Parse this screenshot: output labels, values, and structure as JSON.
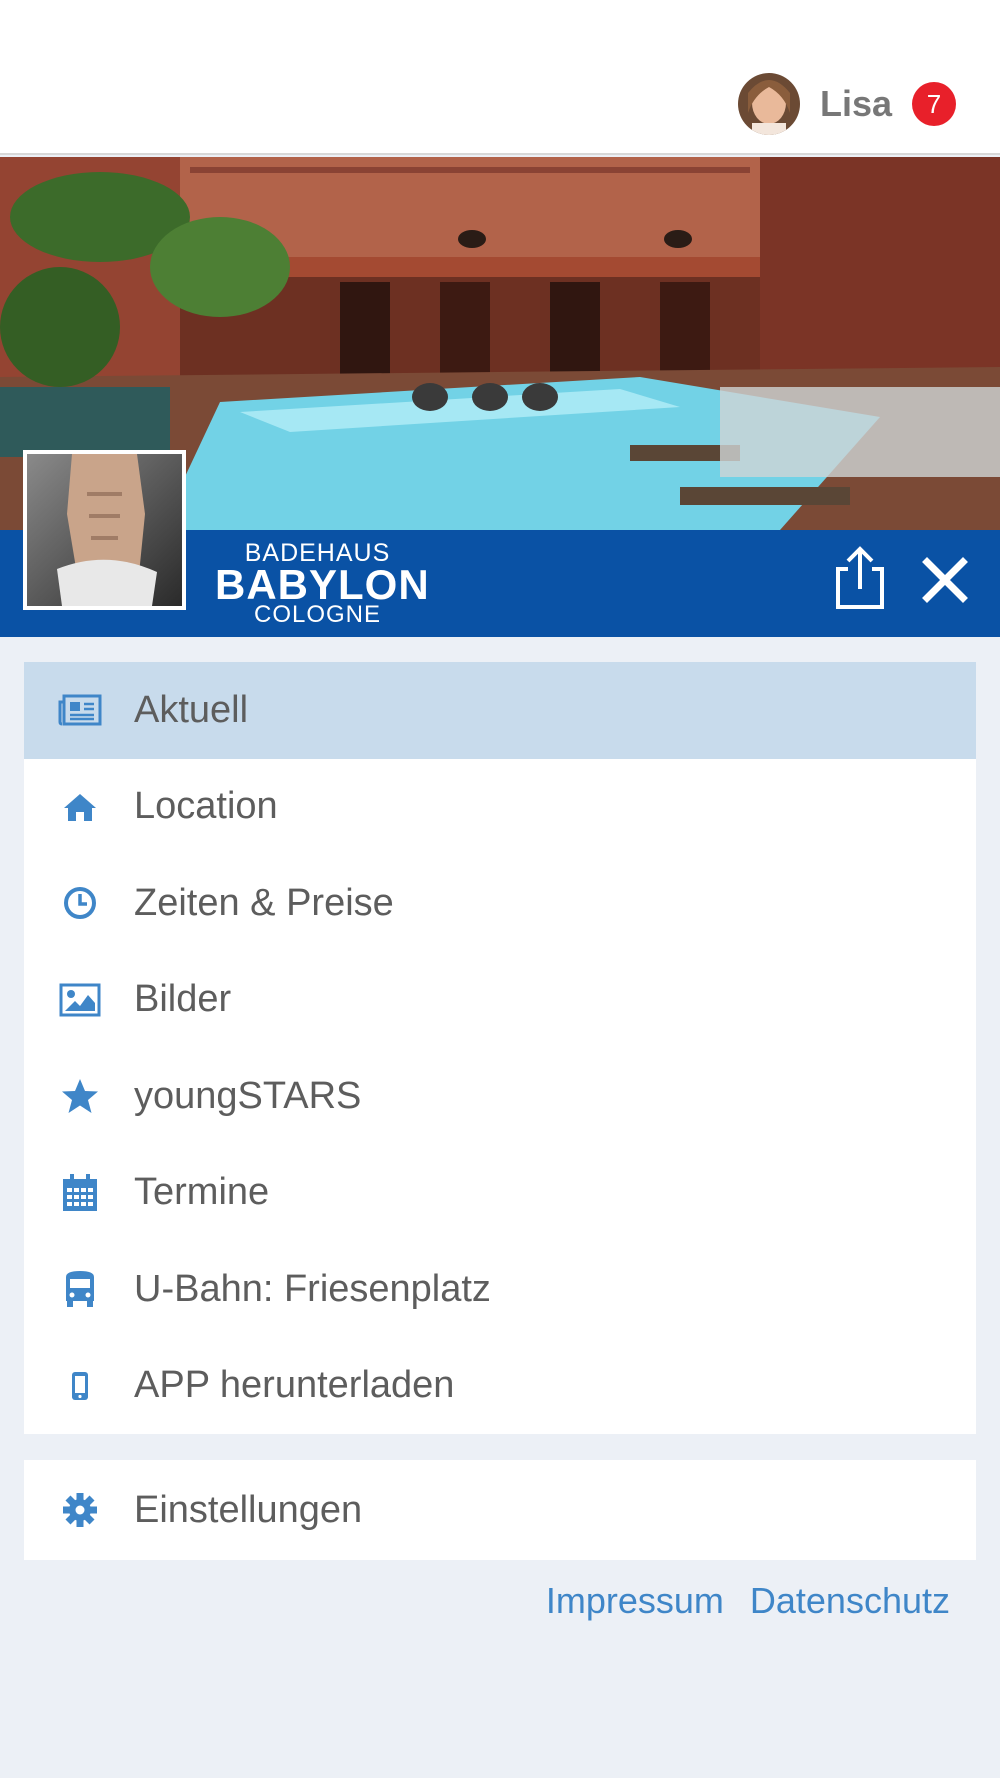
{
  "user": {
    "name": "Lisa",
    "notification_count": "7"
  },
  "brand": {
    "line1": "BADEHAUS",
    "line2": "BABYLON",
    "line3": "COLOGNE"
  },
  "menu": {
    "items": [
      {
        "label": "Aktuell",
        "icon": "newspaper-icon",
        "active": true
      },
      {
        "label": "Location",
        "icon": "home-icon"
      },
      {
        "label": "Zeiten & Preise",
        "icon": "clock-icon"
      },
      {
        "label": "Bilder",
        "icon": "image-icon"
      },
      {
        "label": "youngSTARS",
        "icon": "star-icon"
      },
      {
        "label": "Termine",
        "icon": "calendar-icon"
      },
      {
        "label": "U-Bahn: Friesenplatz",
        "icon": "bus-icon"
      },
      {
        "label": "APP herunterladen",
        "icon": "mobile-phone-icon"
      }
    ],
    "settings": {
      "label": "Einstellungen",
      "icon": "gear-icon"
    }
  },
  "footer": {
    "impressum": "Impressum",
    "datenschutz": "Datenschutz"
  },
  "colors": {
    "brand_blue": "#0a52a5",
    "accent_blue": "#3f86c8",
    "active_bg": "#c8dbec",
    "badge_red": "#e8202a"
  }
}
